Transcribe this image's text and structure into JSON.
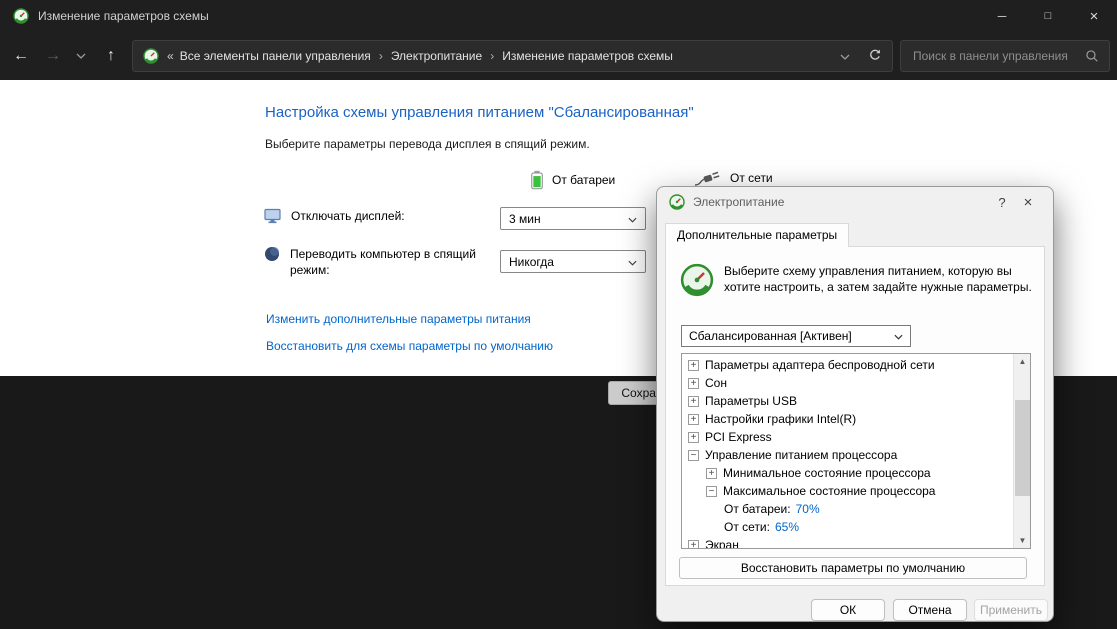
{
  "window": {
    "title": "Изменение параметров схемы",
    "minimize_glyph": "─",
    "maximize_glyph": "□",
    "close_glyph": "×"
  },
  "nav": {
    "back_glyph": "←",
    "forward_glyph": "→",
    "up_glyph": "↑",
    "collapse_glyph": "«",
    "separator_glyph": "›",
    "breadcrumb": [
      "Все элементы панели управления",
      "Электропитание",
      "Изменение параметров схемы"
    ],
    "search_placeholder": "Поиск в панели управления"
  },
  "main": {
    "title": "Настройка схемы управления питанием \"Сбалансированная\"",
    "subtitle": "Выберите параметры перевода дисплея в спящий режим.",
    "columns": {
      "battery": "От батареи",
      "ac": "От сети"
    },
    "rows": [
      {
        "label": "Отключать дисплей:",
        "value": "3 мин"
      },
      {
        "label": "Переводить компьютер в спящий режим:",
        "value": "Никогда"
      }
    ],
    "links": [
      "Изменить дополнительные параметры питания",
      "Восстановить для схемы параметры по умолчанию"
    ],
    "save_button": "Сохранить изменения"
  },
  "dialog": {
    "title": "Электропитание",
    "help_glyph": "?",
    "close_glyph": "×",
    "tab": "Дополнительные параметры",
    "description": "Выберите схему управления питанием, которую вы хотите настроить, а затем задайте нужные параметры.",
    "scheme_select": "Сбалансированная [Активен]",
    "tree": [
      {
        "expand": "+",
        "label": "Параметры адаптера беспроводной сети"
      },
      {
        "expand": "+",
        "label": "Сон"
      },
      {
        "expand": "+",
        "label": "Параметры USB"
      },
      {
        "expand": "+",
        "label": "Настройки графики Intel(R)"
      },
      {
        "expand": "+",
        "label": "PCI Express"
      },
      {
        "expand": "−",
        "label": "Управление питанием процессора"
      },
      {
        "expand": "+",
        "label": "Минимальное состояние процессора"
      },
      {
        "expand": "−",
        "label": "Максимальное состояние процессора"
      },
      {
        "label": "От батареи:",
        "value": "70%"
      },
      {
        "label": "От сети:",
        "value": "65%"
      },
      {
        "expand": "+",
        "label": "Экран"
      }
    ],
    "scroll_up_glyph": "▲",
    "scroll_down_glyph": "▼",
    "restore_button": "Восстановить параметры по умолчанию",
    "ok_button": "ОК",
    "cancel_button": "Отмена",
    "apply_button": "Применить"
  }
}
